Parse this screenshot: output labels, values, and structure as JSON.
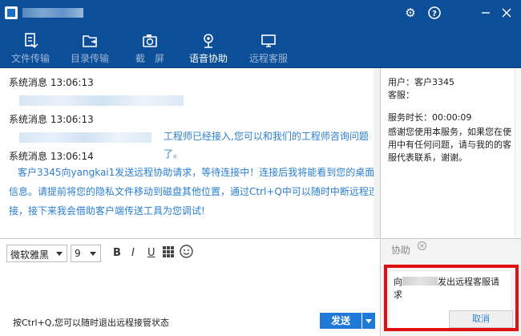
{
  "window": {
    "title_obscured": true
  },
  "toolbar": {
    "items": [
      {
        "label": "文件传输",
        "icon": "file-transfer-icon"
      },
      {
        "label": "目录传输",
        "icon": "folder-transfer-icon"
      },
      {
        "label": "截　屏",
        "icon": "camera-icon"
      },
      {
        "label": "语音协助",
        "icon": "microphone-icon"
      },
      {
        "label": "远程客服",
        "icon": "monitor-icon"
      }
    ]
  },
  "chat": {
    "messages": [
      {
        "header": "系统消息 13:06:13"
      },
      {
        "header": "系统消息 13:06:13",
        "text": "工程师已经接入,您可以和我们的工程师咨询问题了。"
      },
      {
        "header": "系统消息 13:06:14",
        "lines": [
          "客户3345向yangkai1发送远程协助请求，等待连接中！连接后我将能看到您的桌面",
          "信息。请提前将您的隐私文件移动到磁盘其他位置，通过Ctrl+Q中可以随时中断远程连",
          "接，接下来我会借助客户端传送工具为您调试!"
        ]
      }
    ]
  },
  "side": {
    "user": "用户：客户3345",
    "agent": "客服：",
    "duration": "服务时长：00:00:09",
    "thanks": "感谢您使用本服务，如果您在使用中有任何问题，请与我的的客服代表联系，谢谢。"
  },
  "composer": {
    "font": "微软雅黑",
    "size": "9",
    "bold": "B",
    "italic": "I",
    "underline": "U",
    "hint": "按Ctrl+Q,您可以随时退出远程接管状态",
    "send": "发送"
  },
  "assist": {
    "tab": "协助",
    "msg_prefix": "向",
    "msg_suffix": "发出远程客服请求",
    "cancel": "取消"
  },
  "colors": {
    "titlebar": "#0c4e97",
    "link_blue": "#2a7fd0",
    "send_blue": "#1f79d6",
    "highlight_red": "#e01010"
  }
}
